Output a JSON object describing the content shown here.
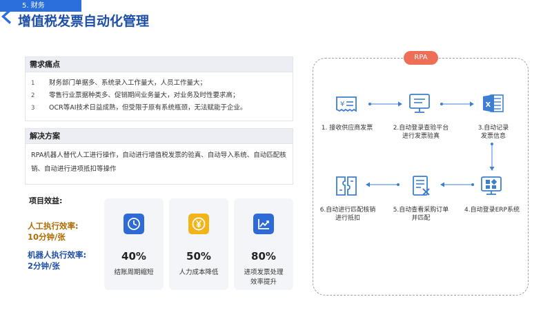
{
  "header": {
    "tag": "5. 财务",
    "title": "增值税发票自动化管理"
  },
  "pain": {
    "title": "需求痛点",
    "items": [
      {
        "num": "1",
        "text": "财务部门单据多、系统录入工作量大，人员工作量大；"
      },
      {
        "num": "2",
        "text": "零售行业票据种类多、促销期间业务量大，对业务及时性要求高；"
      },
      {
        "num": "3",
        "text": "OCR等AI技术日益成熟，但受限于原有系统瓶颈，无法赋能于企业。"
      }
    ]
  },
  "solution": {
    "title": "解决方案",
    "text": "RPA机器人替代人工进行操作，自动进行增值税发票的验真、自动导入系统、自动匹配核销、自动进行进项抵扣等操作"
  },
  "benefits": {
    "title": "项目效益:",
    "human": [
      "人工执行效率:",
      "10分钟/张"
    ],
    "robot": [
      "机器人执行效率:",
      "2分钟/张"
    ],
    "cards": [
      {
        "value": "40%",
        "desc": [
          "结账周期缩短"
        ],
        "icon": "clock-icon",
        "color": "#2f6bd6"
      },
      {
        "value": "50%",
        "desc": [
          "人力成本降低"
        ],
        "icon": "yuan-coin-icon",
        "color": "#f2b417"
      },
      {
        "value": "80%",
        "desc": [
          "进项发票处理",
          "效率提升"
        ],
        "icon": "trend-chart-icon",
        "color": "#2f6bd6"
      }
    ]
  },
  "rpa": {
    "badge": "RPA",
    "steps": [
      {
        "label": [
          "1. 接收供应商发票"
        ],
        "icon": "invoice-receipt-icon"
      },
      {
        "label": [
          "2.自动登录查验平台",
          "进行发票验真"
        ],
        "icon": "monitor-login-icon"
      },
      {
        "label": [
          "3.自动记录",
          "发票信息"
        ],
        "icon": "excel-file-icon"
      },
      {
        "label": [
          "4.自动登录ERP系统"
        ],
        "icon": "erp-dashboard-icon"
      },
      {
        "label": [
          "5.自动查看采购订单",
          "并匹配"
        ],
        "icon": "document-check-icon"
      },
      {
        "label": [
          "6.自动进行匹配核销",
          "进行抵扣"
        ],
        "icon": "puzzle-match-icon"
      }
    ]
  },
  "colors": {
    "accent": "#2a6fdb",
    "title": "#1d4fa8",
    "badge": "#ee6f57",
    "gold": "#b06a00",
    "icon_line": "#3c7fd1"
  }
}
